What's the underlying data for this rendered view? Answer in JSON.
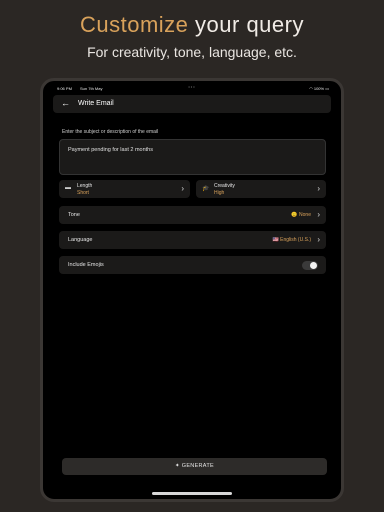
{
  "promo": {
    "title_accent": "Customize",
    "title_rest": " your query",
    "subtitle": "For creativity, tone, language, etc."
  },
  "statusbar": {
    "time": "9:06 PM",
    "date": "Sun 7th May",
    "battery": "100%"
  },
  "navbar": {
    "back_icon": "back-arrow",
    "title": "Write Email"
  },
  "form": {
    "prompt_label": "Enter the subject or description of the email",
    "prompt_value": "Payment pending for last 2 months",
    "length": {
      "label": "Length",
      "value": "Short",
      "icon": "length-icon"
    },
    "creativity": {
      "label": "Creativity",
      "value": "High",
      "icon": "graduation-cap-icon"
    },
    "tone": {
      "label": "Tone",
      "value": "😐 None"
    },
    "language": {
      "label": "Language",
      "value": "🇺🇸 English (U.S.)"
    },
    "emojis": {
      "label": "Include Emojis",
      "enabled": false
    }
  },
  "generate_label": "GENERATE",
  "colors": {
    "accent": "#d9a25b",
    "background": "#2b2724",
    "card": "#1b1a19"
  }
}
